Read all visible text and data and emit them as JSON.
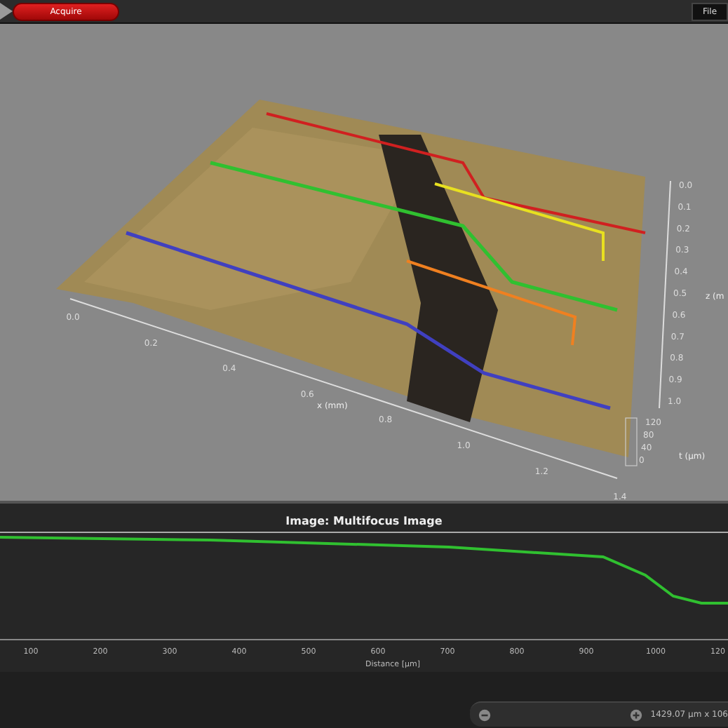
{
  "toolbar": {
    "acquire_button": "Acquire",
    "file_button": "File"
  },
  "view_3d": {
    "x_axis": {
      "label": "x (mm)",
      "ticks": [
        "0.0",
        "0.2",
        "0.4",
        "0.6",
        "0.8",
        "1.0",
        "1.2",
        "1.4"
      ]
    },
    "z_axis": {
      "label": "z (m",
      "ticks": [
        "0.0",
        "0.1",
        "0.2",
        "0.3",
        "0.4",
        "0.5",
        "0.6",
        "0.7",
        "0.8",
        "0.9",
        "1.0"
      ]
    },
    "t_axis": {
      "label": "t (µm)",
      "ticks": [
        "120",
        "80",
        "40",
        "0"
      ]
    }
  },
  "profile": {
    "title": "Image: Multifocus Image",
    "x_ticks": [
      "100",
      "200",
      "300",
      "400",
      "500",
      "600",
      "700",
      "800",
      "900",
      "1000",
      "120"
    ],
    "x_label": "Distance [µm]"
  },
  "status_bar": {
    "dimensions": "1429.07 µm x 106"
  }
}
